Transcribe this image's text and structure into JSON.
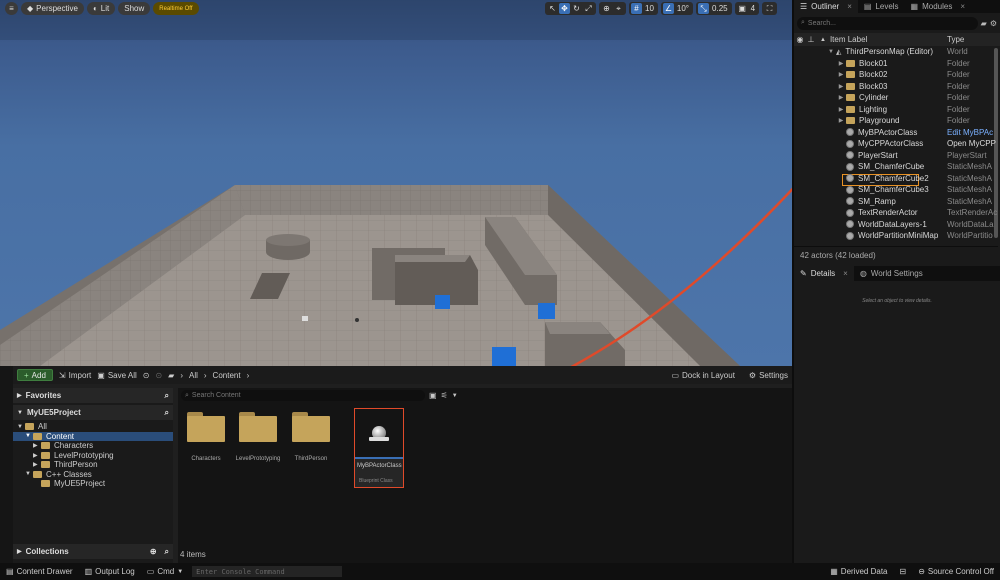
{
  "viewport": {
    "menu_icon": "hamburger-icon",
    "perspective_label": "Perspective",
    "lit_label": "Lit",
    "show_label": "Show",
    "realtime_label": "Realtime Off",
    "grid_snap": "10",
    "rotation_snap": "10°",
    "scale_snap": "0.25",
    "camera_speed": "4"
  },
  "outliner": {
    "tabs": [
      {
        "label": "Outliner",
        "icon": "outliner-icon"
      },
      {
        "label": "Levels",
        "icon": "levels-icon"
      },
      {
        "label": "Modules",
        "icon": "modules-icon"
      }
    ],
    "search_placeholder": "Search...",
    "col_label": "Item Label",
    "col_type": "Type",
    "map": {
      "label": "ThirdPersonMap (Editor)",
      "type": "World"
    },
    "rows": [
      {
        "label": "Block01",
        "type": "Folder",
        "kind": "folder"
      },
      {
        "label": "Block02",
        "type": "Folder",
        "kind": "folder"
      },
      {
        "label": "Block03",
        "type": "Folder",
        "kind": "folder"
      },
      {
        "label": "Cylinder",
        "type": "Folder",
        "kind": "folder"
      },
      {
        "label": "Lighting",
        "type": "Folder",
        "kind": "folder"
      },
      {
        "label": "Playground",
        "type": "Folder",
        "kind": "folder"
      },
      {
        "label": "MyBPActorClass",
        "type": "Edit MyBPAc",
        "kind": "actor"
      },
      {
        "label": "MyCPPActorClass",
        "type": "Open MyCPP",
        "kind": "actor"
      },
      {
        "label": "PlayerStart",
        "type": "PlayerStart",
        "kind": "actor"
      },
      {
        "label": "SM_ChamferCube",
        "type": "StaticMeshA",
        "kind": "actor"
      },
      {
        "label": "SM_ChamferCube2",
        "type": "StaticMeshA",
        "kind": "actor"
      },
      {
        "label": "SM_ChamferCube3",
        "type": "StaticMeshA",
        "kind": "actor"
      },
      {
        "label": "SM_Ramp",
        "type": "StaticMeshA",
        "kind": "actor"
      },
      {
        "label": "TextRenderActor",
        "type": "TextRenderAct",
        "kind": "actor"
      },
      {
        "label": "WorldDataLayers-1",
        "type": "WorldDataLa",
        "kind": "actor"
      },
      {
        "label": "WorldPartitionMiniMap",
        "type": "WorldPartitio",
        "kind": "actor"
      }
    ],
    "status": "42 actors (42 loaded)"
  },
  "details": {
    "tab_details": "Details",
    "tab_world": "World Settings",
    "empty_hint": "Select an object to view details."
  },
  "content_browser": {
    "add_label": "Add",
    "import_label": "Import",
    "save_all_label": "Save All",
    "path": [
      "All",
      "Content"
    ],
    "dock_label": "Dock in Layout",
    "settings_label": "Settings",
    "favorites_label": "Favorites",
    "project_label": "MyUE5Project",
    "search_placeholder": "Search Content",
    "tree": [
      {
        "label": "All",
        "indent": 0
      },
      {
        "label": "Content",
        "indent": 1
      },
      {
        "label": "Characters",
        "indent": 2
      },
      {
        "label": "LevelPrototyping",
        "indent": 2
      },
      {
        "label": "ThirdPerson",
        "indent": 2
      },
      {
        "label": "C++ Classes",
        "indent": 1
      },
      {
        "label": "MyUE5Project",
        "indent": 2
      }
    ],
    "tiles": [
      {
        "label": "Characters"
      },
      {
        "label": "LevelPrototyping"
      },
      {
        "label": "ThirdPerson"
      }
    ],
    "blueprint": {
      "label": "MyBPActorClass",
      "type": "Blueprint Class"
    },
    "collections_label": "Collections",
    "item_count": "4 items"
  },
  "bottombar": {
    "content_drawer": "Content Drawer",
    "output_log": "Output Log",
    "cmd": "Cmd",
    "console_placeholder": "Enter Console Command",
    "derived_data": "Derived Data",
    "source_control": "Source Control Off"
  },
  "colors": {
    "accent_blue": "#3a6fb5",
    "highlight_orange": "#e89225",
    "callout_red": "#e04a2a",
    "folder": "#c5a45b"
  }
}
